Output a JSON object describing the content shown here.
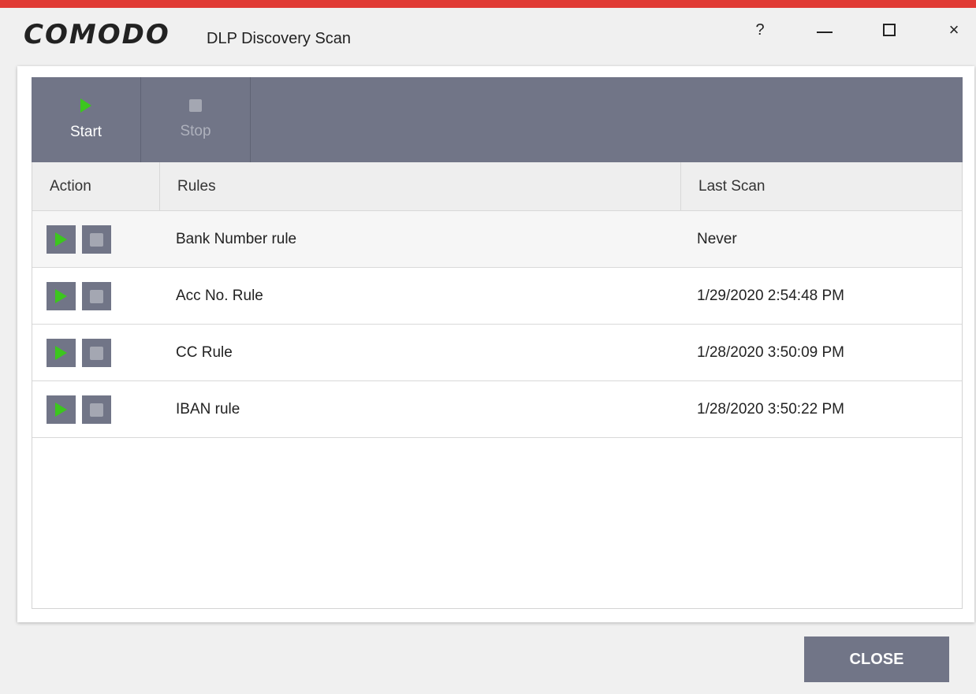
{
  "window": {
    "brand": "COMODO",
    "title": "DLP Discovery Scan",
    "help_label": "?",
    "close_label": "×"
  },
  "toolbar": {
    "start_label": "Start",
    "stop_label": "Stop"
  },
  "table": {
    "headers": {
      "action": "Action",
      "rules": "Rules",
      "last_scan": "Last Scan"
    },
    "rows": [
      {
        "rule": "Bank Number rule",
        "last_scan": "Never"
      },
      {
        "rule": "Acc No. Rule",
        "last_scan": "1/29/2020 2:54:48 PM"
      },
      {
        "rule": "CC Rule",
        "last_scan": "1/28/2020 3:50:09 PM"
      },
      {
        "rule": "IBAN rule",
        "last_scan": "1/28/2020 3:50:22 PM"
      }
    ]
  },
  "footer": {
    "close_button_label": "CLOSE"
  },
  "colors": {
    "accent_red": "#e03a34",
    "toolbar_bg": "#717587",
    "play_green": "#3cc61e"
  }
}
